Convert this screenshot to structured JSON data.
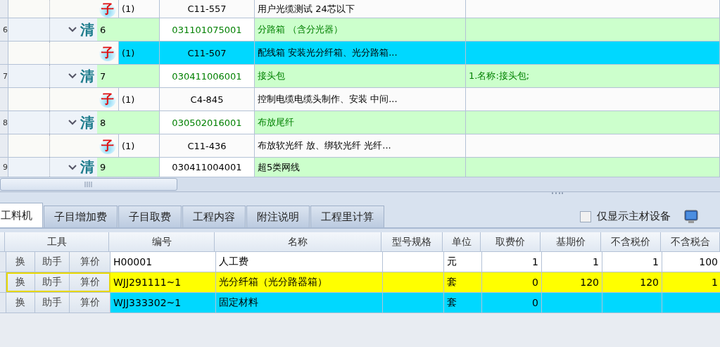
{
  "tree_rows": [
    {
      "kind": "sub",
      "badge": "子",
      "index": "(1)",
      "code": "C11-557",
      "name": "用户光缆测试 24芯以下",
      "description": "",
      "selected": false
    },
    {
      "kind": "item",
      "row_number": "6",
      "badge": "清",
      "index": "6",
      "code": "031101075001",
      "name": "分路箱  （含分光器）",
      "description": "",
      "color": "#008000",
      "selected": false
    },
    {
      "kind": "sub",
      "badge": "子",
      "index": "(1)",
      "code": "C11-507",
      "name": "配线箱 安装光分纤箱、光分路箱...",
      "description": "",
      "selected": true
    },
    {
      "kind": "item",
      "row_number": "7",
      "badge": "清",
      "index": "7",
      "code": "030411006001",
      "name": "接头包",
      "description": "1.名称:接头包;",
      "color": "#008000",
      "selected": false
    },
    {
      "kind": "sub",
      "badge": "子",
      "index": "(1)",
      "code": "C4-845",
      "name": "控制电缆电缆头制作、安装 中间...",
      "description": "",
      "selected": false
    },
    {
      "kind": "item",
      "row_number": "8",
      "badge": "清",
      "index": "8",
      "code": "030502016001",
      "name": "布放尾纤",
      "description": "",
      "color": "#008000",
      "selected": false
    },
    {
      "kind": "sub",
      "badge": "子",
      "index": "(1)",
      "code": "C11-436",
      "name": "布放软光纤 放、绑软光纤 光纤...",
      "description": "",
      "selected": false
    },
    {
      "kind": "item",
      "row_number": "9",
      "badge": "清",
      "index": "9",
      "code": "030411004001",
      "name": "超5类网线",
      "description": "",
      "color": "#000000",
      "selected": false
    }
  ],
  "tabs": [
    {
      "label": "工料机",
      "selected": true
    },
    {
      "label": "子目增加费",
      "selected": false
    },
    {
      "label": "子目取费",
      "selected": false
    },
    {
      "label": "工程内容",
      "selected": false
    },
    {
      "label": "附注说明",
      "selected": false
    },
    {
      "label": "工程里计算",
      "selected": false
    }
  ],
  "main_material_only": {
    "label": "仅显示主材设备",
    "checked": false
  },
  "table": {
    "tools_header": "工具",
    "columns": [
      "编号",
      "名称",
      "型号规格",
      "单位",
      "取费价",
      "基期价",
      "不含税价",
      "不含税合"
    ],
    "rows": [
      {
        "tools": [
          "换",
          "助手",
          "算价"
        ],
        "cells": [
          "H00001",
          "人工费",
          "",
          "元",
          "1",
          "1",
          "1",
          "100"
        ],
        "highlighted": false,
        "selected": false
      },
      {
        "tools": [
          "换",
          "助手",
          "算价"
        ],
        "cells": [
          "WJJ291111~1",
          "光分纤箱（光分路器箱）",
          "",
          "套",
          "0",
          "120",
          "120",
          "1"
        ],
        "highlighted": true,
        "selected": false
      },
      {
        "tools": [
          "换",
          "助手",
          "算价"
        ],
        "cells": [
          "WJJ333302~1",
          "固定材料",
          "",
          "套",
          "0",
          "",
          "",
          ""
        ],
        "highlighted": false,
        "selected": true
      }
    ]
  }
}
